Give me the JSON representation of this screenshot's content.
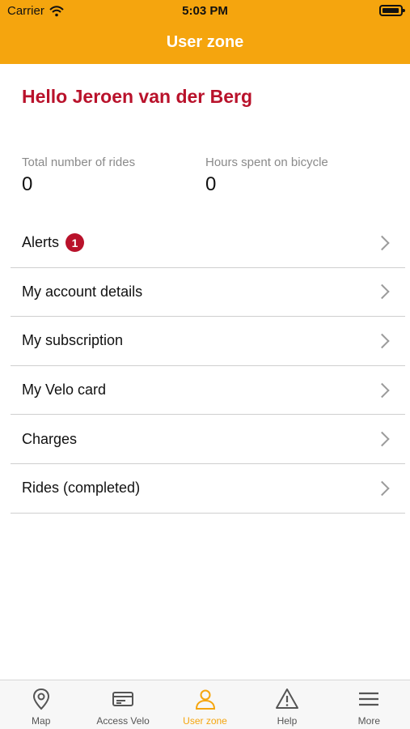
{
  "status_bar": {
    "carrier": "Carrier",
    "time": "5:03 PM"
  },
  "header": {
    "title": "User zone"
  },
  "greeting": "Hello Jeroen van der Berg",
  "stats": [
    {
      "label": "Total number of rides",
      "value": "0"
    },
    {
      "label": "Hours spent on bicycle",
      "value": "0"
    }
  ],
  "menu": [
    {
      "label": "Alerts",
      "badge": "1"
    },
    {
      "label": "My account details"
    },
    {
      "label": "My subscription"
    },
    {
      "label": "My Velo card"
    },
    {
      "label": "Charges"
    },
    {
      "label": "Rides (completed)"
    }
  ],
  "tabs": [
    {
      "label": "Map",
      "icon": "map-pin-icon"
    },
    {
      "label": "Access Velo",
      "icon": "card-icon"
    },
    {
      "label": "User zone",
      "icon": "user-icon",
      "active": true
    },
    {
      "label": "Help",
      "icon": "warning-icon"
    },
    {
      "label": "More",
      "icon": "menu-icon"
    }
  ],
  "colors": {
    "accent": "#f5a50e",
    "brand_red": "#b9122b"
  }
}
